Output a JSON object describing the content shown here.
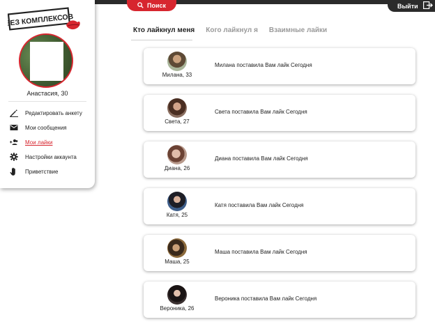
{
  "header": {
    "search_label": "Поиск",
    "logout_label": "Выйти"
  },
  "logo": {
    "text": "БЕЗ КОМПЛЕКСОВ"
  },
  "profile": {
    "name": "Анастасия, 30"
  },
  "menu": {
    "items": [
      {
        "label": "Редактировать анкету",
        "icon": "pencil-icon"
      },
      {
        "label": "Мои сообщения",
        "icon": "envelope-icon"
      },
      {
        "label": "Мои лайки",
        "icon": "people-add-icon",
        "active": true
      },
      {
        "label": "Настройки аккаунта",
        "icon": "gear-icon"
      },
      {
        "label": "Приветствие",
        "icon": "hand-icon"
      }
    ]
  },
  "tabs": [
    {
      "label": "Кто лайкнул меня",
      "active": true
    },
    {
      "label": "Кого лайкнул я"
    },
    {
      "label": "Взаимные лайки"
    }
  ],
  "likes": [
    {
      "name": "Милана, 33",
      "text": "Милана поставила Вам лайк Сегодня"
    },
    {
      "name": "Света, 27",
      "text": "Света поставила Вам лайк Сегодня"
    },
    {
      "name": "Диана, 26",
      "text": "Диана поставила Вам лайк Сегодня"
    },
    {
      "name": "Катя, 25",
      "text": "Катя поставила Вам лайк Сегодня"
    },
    {
      "name": "Маша, 25",
      "text": "Маша поставила Вам лайк Сегодня"
    },
    {
      "name": "Вероника, 26",
      "text": "Вероника поставила Вам лайк Сегодня"
    }
  ],
  "colors": {
    "accent": "#d7262f",
    "dark": "#2b2b2b"
  }
}
